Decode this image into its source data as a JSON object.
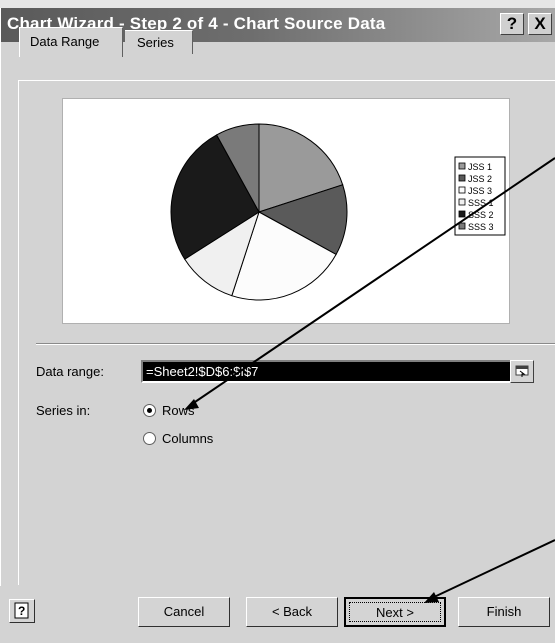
{
  "window": {
    "title": "Chart Wizard - Step 2 of 4 - Chart Source Data",
    "help_glyph": "?",
    "close_glyph": "X"
  },
  "tabs": [
    {
      "label": "Data Range",
      "active": true
    },
    {
      "label": "Series",
      "active": false
    }
  ],
  "preview": {
    "chart_data": {
      "type": "pie",
      "series": [
        {
          "name": "JSS 1",
          "value": 20,
          "color": "#9a9a9a"
        },
        {
          "name": "JSS 2",
          "value": 13,
          "color": "#5a5a5a"
        },
        {
          "name": "JSS 3",
          "value": 22,
          "color": "#fcfcfc"
        },
        {
          "name": "SSS 1",
          "value": 11,
          "color": "#f0f0f0"
        },
        {
          "name": "SSS 2",
          "value": 26,
          "color": "#1a1a1a"
        },
        {
          "name": "SSS 3",
          "value": 8,
          "color": "#7a7a7a"
        }
      ]
    }
  },
  "form": {
    "data_range_label": "Data range:",
    "data_range_value": "=Sheet2!$D$6:$I$7",
    "series_in_label": "Series in:",
    "options": [
      {
        "label": "Rows",
        "selected": true
      },
      {
        "label": "Columns",
        "selected": false
      }
    ]
  },
  "buttons": {
    "cancel": "Cancel",
    "back": "< Back",
    "next": "Next >",
    "finish": "Finish"
  },
  "colors": {
    "title_bar": "#5a5a5a",
    "dialog_bg": "#d3d3d3",
    "range_highlight": "#000000"
  }
}
